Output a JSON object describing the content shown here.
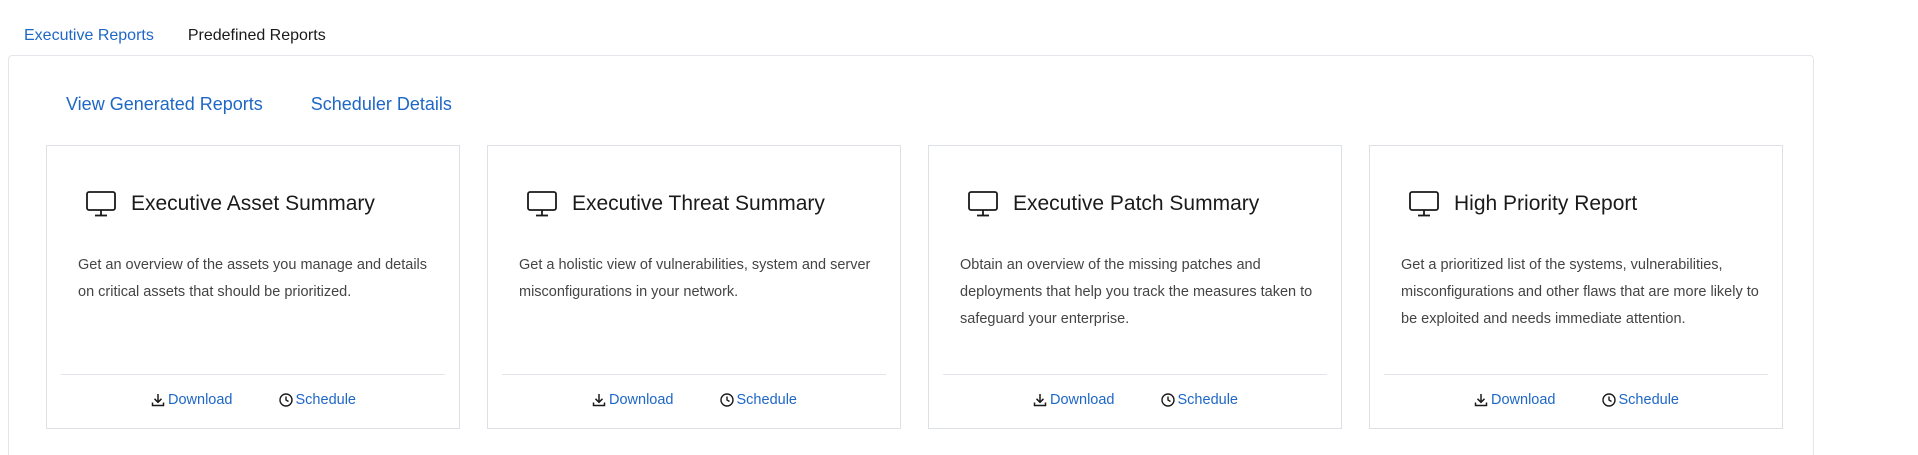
{
  "tabs": [
    {
      "label": "Executive Reports",
      "active": true
    },
    {
      "label": "Predefined Reports",
      "active": false
    }
  ],
  "links": {
    "view_generated": "View Generated Reports",
    "scheduler_details": "Scheduler Details"
  },
  "cards": [
    {
      "icon": "monitor-icon",
      "title": "Executive Asset Summary",
      "description": "Get an overview of the assets you manage and details on critical assets that should be prioritized.",
      "download_label": "Download",
      "schedule_label": "Schedule"
    },
    {
      "icon": "monitor-icon",
      "title": "Executive Threat Summary",
      "description": "Get a holistic view of vulnerabilities, system and server misconfigurations in your network.",
      "download_label": "Download",
      "schedule_label": "Schedule"
    },
    {
      "icon": "monitor-icon",
      "title": "Executive Patch Summary",
      "description": "Obtain an overview of the missing patches and deployments that help you track the measures taken to safeguard your enterprise.",
      "download_label": "Download",
      "schedule_label": "Schedule"
    },
    {
      "icon": "monitor-icon",
      "title": "High Priority Report",
      "description": "Get a prioritized list of the systems, vulnerabilities, misconfigurations and other flaws that are more likely to be exploited and needs immediate attention.",
      "download_label": "Download",
      "schedule_label": "Schedule"
    }
  ],
  "colors": {
    "accent": "#1f67c6",
    "border": "#dde1e6"
  }
}
